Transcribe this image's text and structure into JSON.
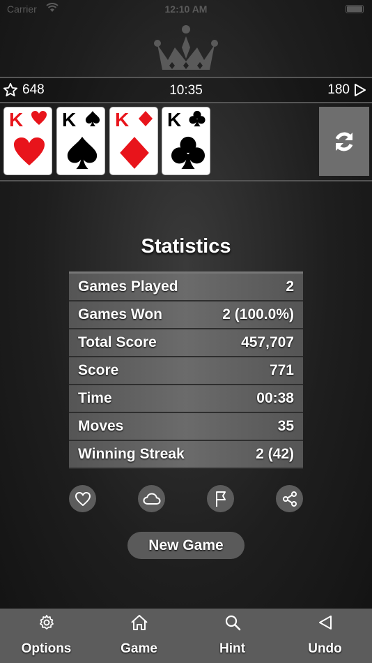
{
  "status_bar": {
    "carrier": "Carrier",
    "time": "12:10 AM"
  },
  "info_bar": {
    "stars": "648",
    "time": "10:35",
    "moves": "180"
  },
  "foundation": [
    {
      "rank": "K",
      "suit": "hearts",
      "color": "#e8141b"
    },
    {
      "rank": "K",
      "suit": "spades",
      "color": "#000000"
    },
    {
      "rank": "K",
      "suit": "diamonds",
      "color": "#e8141b"
    },
    {
      "rank": "K",
      "suit": "clubs",
      "color": "#000000"
    }
  ],
  "statistics": {
    "title": "Statistics",
    "rows": [
      {
        "label": "Games Played",
        "value": "2"
      },
      {
        "label": "Games Won",
        "value": "2 (100.0%)"
      },
      {
        "label": "Total Score",
        "value": "457,707"
      },
      {
        "label": "Score",
        "value": "771"
      },
      {
        "label": "Time",
        "value": "00:38"
      },
      {
        "label": "Moves",
        "value": "35"
      },
      {
        "label": "Winning Streak",
        "value": "2 (42)"
      }
    ]
  },
  "actions": {
    "icons": [
      "heart-icon",
      "cloud-icon",
      "flag-icon",
      "share-icon"
    ]
  },
  "new_game_label": "New Game",
  "tab_bar": {
    "tabs": [
      {
        "label": "Options",
        "icon": "gear-icon"
      },
      {
        "label": "Game",
        "icon": "home-icon"
      },
      {
        "label": "Hint",
        "icon": "search-icon"
      },
      {
        "label": "Undo",
        "icon": "back-triangle-icon"
      }
    ]
  },
  "colors": {
    "accent_gray": "#5c5c5c",
    "red_suit": "#e8141b",
    "background": "#1e1e1e"
  }
}
